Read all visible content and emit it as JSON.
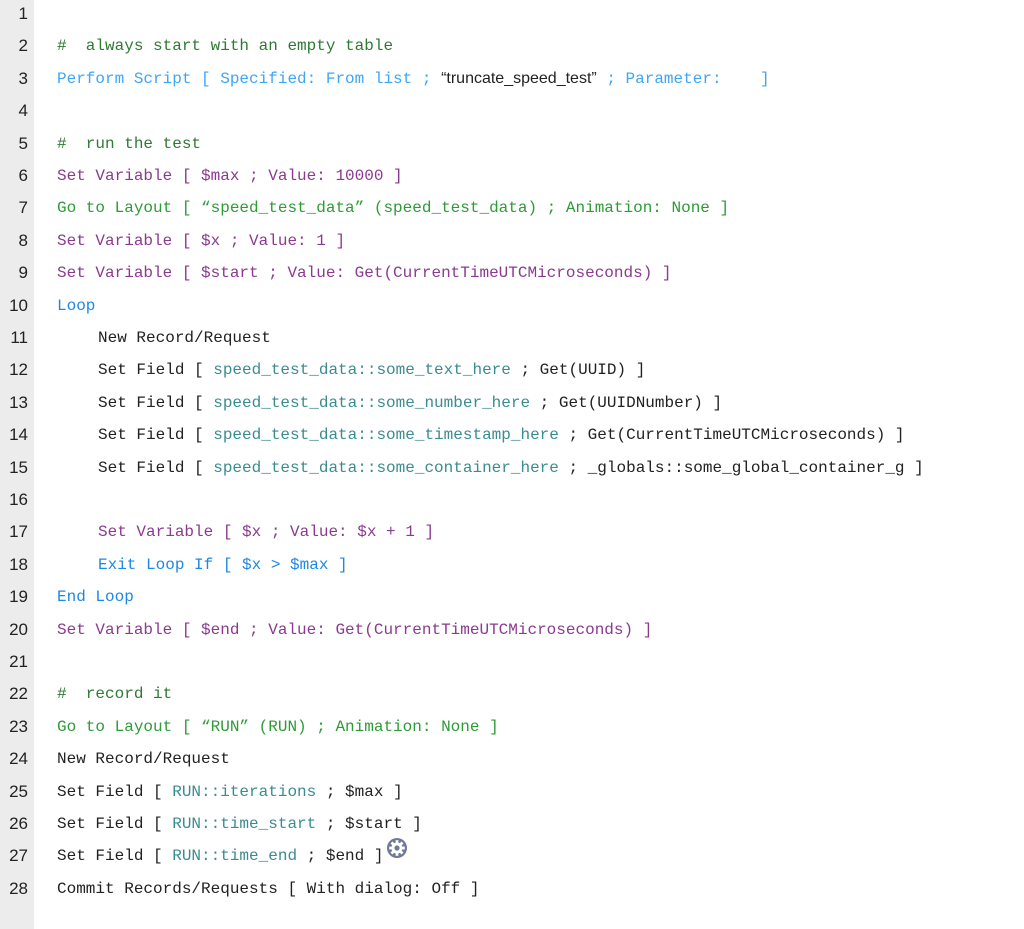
{
  "colors": {
    "comment": "#2f7a33",
    "perform_script": "#3ea6f5",
    "loop": "#1e88e5",
    "set_variable": "#8b3a8f",
    "go_to_layout": "#2e9b37",
    "field": "#3b8b93",
    "default": "#222222",
    "gutter": "#ececec"
  },
  "lines": [
    {
      "n": "1",
      "indent": false,
      "segs": []
    },
    {
      "n": "2",
      "indent": false,
      "segs": [
        [
          "#  always start with an empty table",
          "cm"
        ]
      ]
    },
    {
      "n": "3",
      "indent": false,
      "segs": [
        [
          "Perform Script [ Specified: From list ; ",
          "ps"
        ],
        [
          "“truncate_speed_test”",
          "k pr"
        ],
        [
          " ; Parameter:    ]",
          "ps"
        ]
      ]
    },
    {
      "n": "4",
      "indent": false,
      "segs": []
    },
    {
      "n": "5",
      "indent": false,
      "segs": [
        [
          "#  run the test",
          "cm"
        ]
      ]
    },
    {
      "n": "6",
      "indent": false,
      "segs": [
        [
          "Set Variable [ $max ; Value: 10000 ]",
          "sv"
        ]
      ]
    },
    {
      "n": "7",
      "indent": false,
      "segs": [
        [
          "Go to Layout [ “speed_test_data” (speed_test_data) ; Animation: None ]",
          "gl"
        ]
      ]
    },
    {
      "n": "8",
      "indent": false,
      "segs": [
        [
          "Set Variable [ $x ; Value: 1 ]",
          "sv"
        ]
      ]
    },
    {
      "n": "9",
      "indent": false,
      "segs": [
        [
          "Set Variable [ $start ; Value: Get(CurrentTimeUTCMicroseconds) ]",
          "sv"
        ]
      ]
    },
    {
      "n": "10",
      "indent": false,
      "segs": [
        [
          "Loop",
          "lp"
        ]
      ]
    },
    {
      "n": "11",
      "indent": true,
      "segs": [
        [
          "New Record/Request",
          "k"
        ]
      ]
    },
    {
      "n": "12",
      "indent": true,
      "segs": [
        [
          "Set Field [ ",
          "k"
        ],
        [
          "speed_test_data::some_text_here",
          "fd"
        ],
        [
          " ; Get(UUID) ]",
          "k"
        ]
      ]
    },
    {
      "n": "13",
      "indent": true,
      "segs": [
        [
          "Set Field [ ",
          "k"
        ],
        [
          "speed_test_data::some_number_here",
          "fd"
        ],
        [
          " ; Get(UUIDNumber) ]",
          "k"
        ]
      ]
    },
    {
      "n": "14",
      "indent": true,
      "segs": [
        [
          "Set Field [ ",
          "k"
        ],
        [
          "speed_test_data::some_timestamp_here",
          "fd"
        ],
        [
          " ; Get(CurrentTimeUTCMicroseconds) ]",
          "k"
        ]
      ]
    },
    {
      "n": "15",
      "indent": true,
      "segs": [
        [
          "Set Field [ ",
          "k"
        ],
        [
          "speed_test_data::some_container_here",
          "fd"
        ],
        [
          " ; _globals::some_global_container_g ]",
          "k"
        ]
      ]
    },
    {
      "n": "16",
      "indent": true,
      "segs": []
    },
    {
      "n": "17",
      "indent": true,
      "segs": [
        [
          "Set Variable [ $x ; Value: $x + 1 ]",
          "sv"
        ]
      ]
    },
    {
      "n": "18",
      "indent": true,
      "segs": [
        [
          "Exit Loop If [ $x > $max ]",
          "lp"
        ]
      ]
    },
    {
      "n": "19",
      "indent": false,
      "segs": [
        [
          "End Loop",
          "lp"
        ]
      ]
    },
    {
      "n": "20",
      "indent": false,
      "segs": [
        [
          "Set Variable [ $end ; Value: Get(CurrentTimeUTCMicroseconds) ]",
          "sv"
        ]
      ]
    },
    {
      "n": "21",
      "indent": false,
      "segs": []
    },
    {
      "n": "22",
      "indent": false,
      "segs": [
        [
          "#  record it",
          "cm"
        ]
      ]
    },
    {
      "n": "23",
      "indent": false,
      "segs": [
        [
          "Go to Layout [ “RUN” (RUN) ; Animation: None ]",
          "gl"
        ]
      ]
    },
    {
      "n": "24",
      "indent": false,
      "segs": [
        [
          "New Record/Request",
          "k"
        ]
      ]
    },
    {
      "n": "25",
      "indent": false,
      "segs": [
        [
          "Set Field [ ",
          "k"
        ],
        [
          "RUN::iterations",
          "fd"
        ],
        [
          " ; $max ]",
          "k"
        ]
      ]
    },
    {
      "n": "26",
      "indent": false,
      "segs": [
        [
          "Set Field [ ",
          "k"
        ],
        [
          "RUN::time_start",
          "fd"
        ],
        [
          " ; $start ]",
          "k"
        ]
      ]
    },
    {
      "n": "27",
      "indent": false,
      "segs": [
        [
          "Set Field [ ",
          "k"
        ],
        [
          "RUN::time_end",
          "fd"
        ],
        [
          " ; $end ]",
          "k"
        ]
      ],
      "icon": "gear-icon"
    },
    {
      "n": "28",
      "indent": false,
      "segs": [
        [
          "Commit Records/Requests [ With dialog: Off ]",
          "k"
        ]
      ]
    }
  ]
}
